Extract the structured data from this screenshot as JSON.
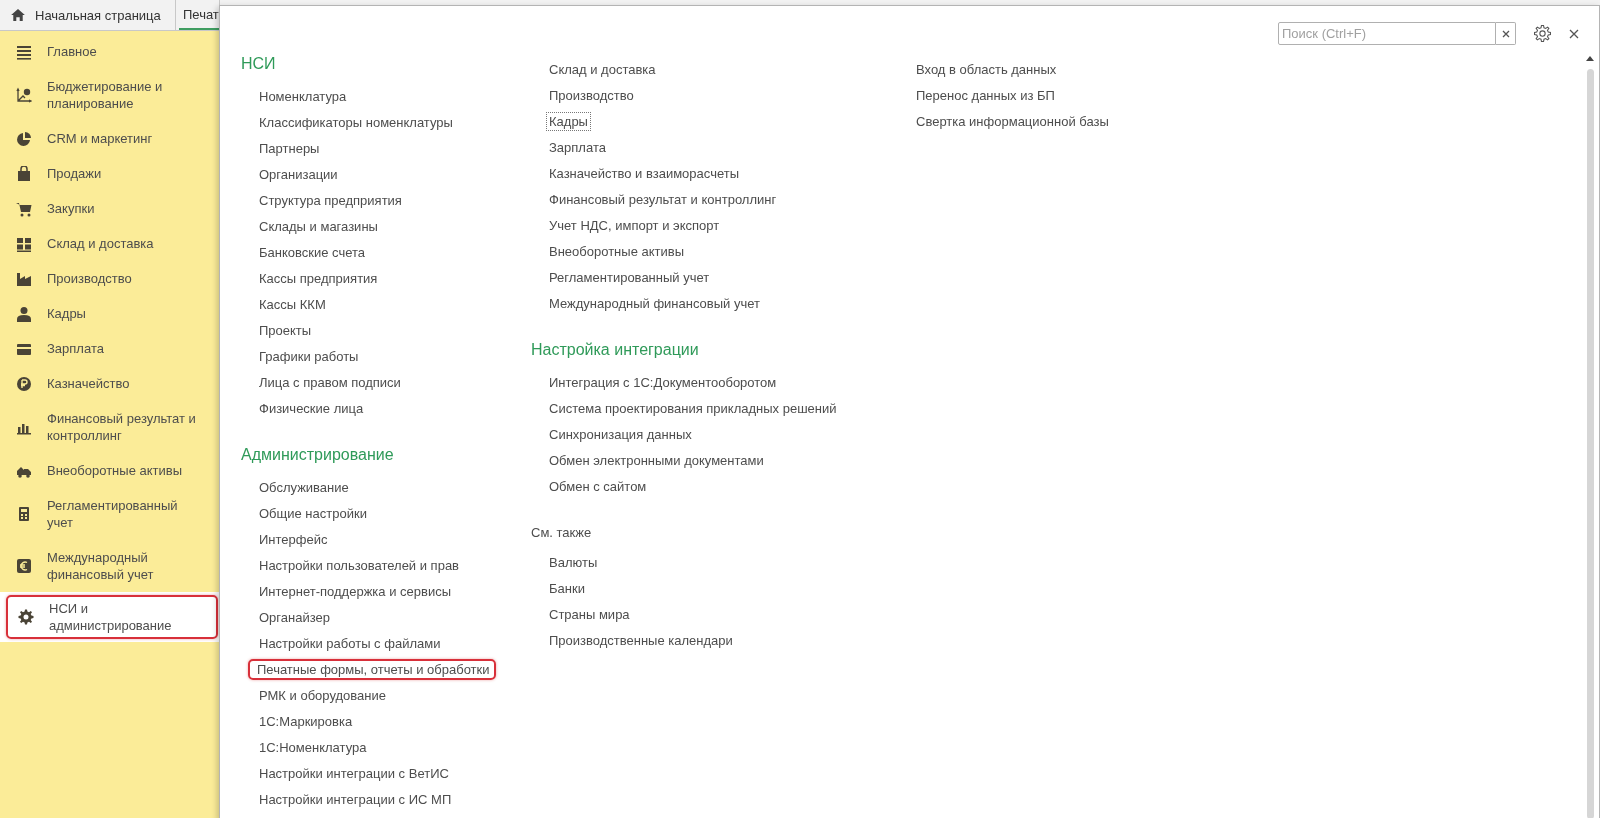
{
  "tabs": [
    {
      "label": "Начальная страница",
      "selected": false
    },
    {
      "label": "Печат",
      "selected": true
    }
  ],
  "sidebar": {
    "items": [
      {
        "label": "Главное",
        "selected": false
      },
      {
        "label": "Бюджетирование и планирование",
        "selected": false
      },
      {
        "label": "CRM и маркетинг",
        "selected": false
      },
      {
        "label": "Продажи",
        "selected": false
      },
      {
        "label": "Закупки",
        "selected": false
      },
      {
        "label": "Склад и доставка",
        "selected": false
      },
      {
        "label": "Производство",
        "selected": false
      },
      {
        "label": "Кадры",
        "selected": false
      },
      {
        "label": "Зарплата",
        "selected": false
      },
      {
        "label": "Казначейство",
        "selected": false
      },
      {
        "label": "Финансовый результат и контроллинг",
        "selected": false
      },
      {
        "label": "Внеоборотные активы",
        "selected": false
      },
      {
        "label": "Регламентированный учет",
        "selected": false
      },
      {
        "label": "Международный финансовый учет",
        "selected": false
      },
      {
        "label": "НСИ и администрирование",
        "selected": true,
        "highlighted": true
      }
    ]
  },
  "panel": {
    "search": {
      "placeholder": "Поиск (Ctrl+F)"
    },
    "columns": [
      {
        "sections": [
          {
            "title": "НСИ",
            "kind": "group",
            "items": [
              {
                "label": "Номенклатура"
              },
              {
                "label": "Классификаторы номенклатуры"
              },
              {
                "label": "Партнеры"
              },
              {
                "label": "Организации"
              },
              {
                "label": "Структура предприятия"
              },
              {
                "label": "Склады и магазины"
              },
              {
                "label": "Банковские счета"
              },
              {
                "label": "Кассы предприятия"
              },
              {
                "label": "Кассы ККМ"
              },
              {
                "label": "Проекты"
              },
              {
                "label": "Графики работы"
              },
              {
                "label": "Лица с правом подписи"
              },
              {
                "label": "Физические лица"
              }
            ]
          },
          {
            "title": "Администрирование",
            "kind": "group",
            "items": [
              {
                "label": "Обслуживание"
              },
              {
                "label": "Общие настройки"
              },
              {
                "label": "Интерфейс"
              },
              {
                "label": "Настройки пользователей и прав"
              },
              {
                "label": "Интернет-поддержка и сервисы"
              },
              {
                "label": "Органайзер"
              },
              {
                "label": "Настройки работы с файлами"
              },
              {
                "label": "Печатные формы, отчеты и обработки",
                "highlighted": true
              },
              {
                "label": "РМК и оборудование"
              },
              {
                "label": "1С:Маркировка"
              },
              {
                "label": "1С:Номенклатура"
              },
              {
                "label": "Настройки интеграции с ВетИС"
              },
              {
                "label": "Настройки интеграции с ИС МП"
              }
            ]
          }
        ]
      },
      {
        "sections": [
          {
            "items": [
              {
                "label": "Склад и доставка"
              },
              {
                "label": "Производство"
              },
              {
                "label": "Кадры",
                "focused": true
              },
              {
                "label": "Зарплата"
              },
              {
                "label": "Казначейство и взаиморасчеты"
              },
              {
                "label": "Финансовый результат и контроллинг"
              },
              {
                "label": "Учет НДС, импорт и экспорт"
              },
              {
                "label": "Внеоборотные активы"
              },
              {
                "label": "Регламентированный учет"
              },
              {
                "label": "Международный финансовый учет"
              }
            ]
          },
          {
            "title": "Настройка интеграции",
            "kind": "group",
            "items": [
              {
                "label": "Интеграция с 1С:Документооборотом"
              },
              {
                "label": "Система проектирования прикладных решений"
              },
              {
                "label": "Синхронизация данных"
              },
              {
                "label": "Обмен электронными документами"
              },
              {
                "label": "Обмен с сайтом"
              }
            ]
          },
          {
            "title": "См. также",
            "kind": "see_also",
            "items": [
              {
                "label": "Валюты"
              },
              {
                "label": "Банки"
              },
              {
                "label": "Страны мира"
              },
              {
                "label": "Производственные календари"
              }
            ]
          }
        ]
      },
      {
        "sections": [
          {
            "items": [
              {
                "label": "Вход в область данных"
              },
              {
                "label": "Перенос данных из БП"
              },
              {
                "label": "Свертка информационной базы"
              }
            ]
          }
        ]
      }
    ]
  }
}
